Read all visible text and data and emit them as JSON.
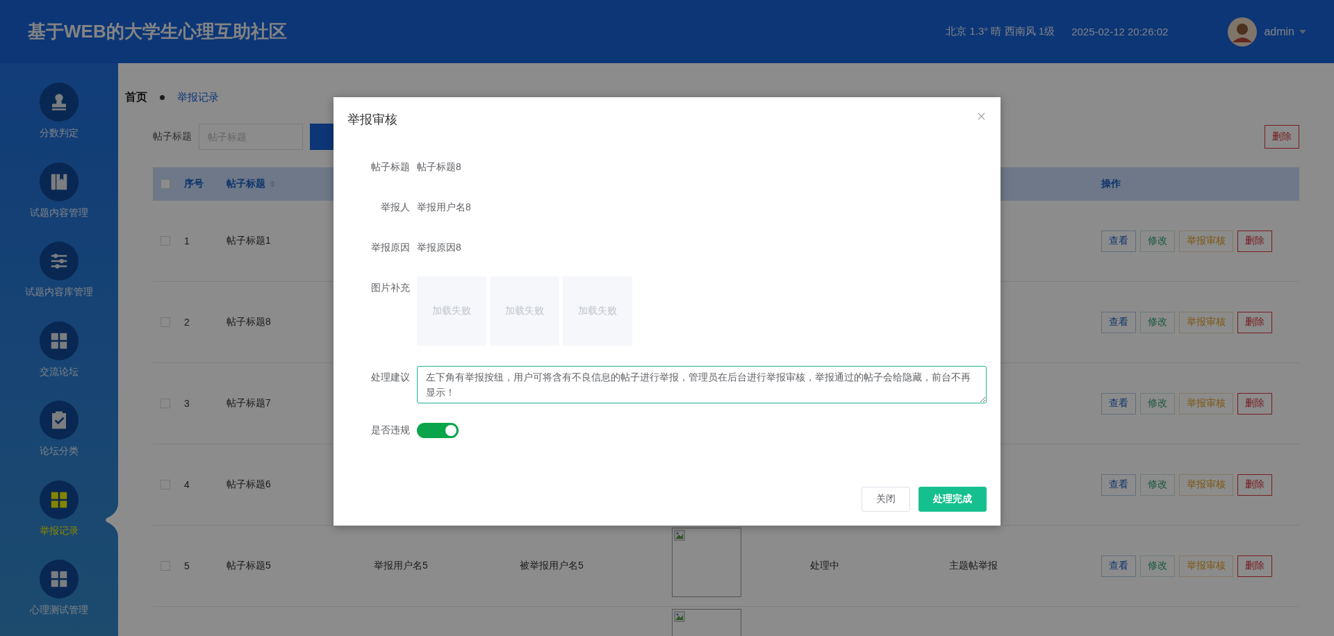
{
  "header": {
    "title": "基于WEB的大学生心理互助社区",
    "weather": "北京 1.3° 晴 西南风 1级",
    "datetime": "2025-02-12 20:26:02",
    "user": "admin"
  },
  "sidebar": {
    "items": [
      {
        "label": "分数判定",
        "kind": "stamp",
        "selected": false
      },
      {
        "label": "试题内容管理",
        "kind": "book",
        "selected": false
      },
      {
        "label": "试题内容库管理",
        "kind": "sliders",
        "selected": false
      },
      {
        "label": "交流论坛",
        "kind": "grid",
        "selected": false
      },
      {
        "label": "论坛分类",
        "kind": "clipboard",
        "selected": false
      },
      {
        "label": "举报记录",
        "kind": "grid",
        "selected": true
      },
      {
        "label": "心理测试管理",
        "kind": "grid",
        "selected": false
      }
    ]
  },
  "breadcrumb": [
    "首页",
    "举报记录"
  ],
  "search": {
    "label": "帖子标题",
    "placeholder": "帖子标题"
  },
  "delete_button": "删除",
  "table": {
    "header_checked": false,
    "columns": [
      {
        "label": "序号",
        "kind": "plain"
      },
      {
        "label": "帖子标题",
        "kind": "sortable"
      }
    ],
    "actions_column": "操作",
    "rows": [
      {
        "checked": false,
        "no": "1",
        "title": "帖子标题1",
        "actions": [
          {
            "label": "查看",
            "kind": "view"
          },
          {
            "label": "修改",
            "kind": "edit"
          },
          {
            "label": "举报审核",
            "kind": "audit"
          },
          {
            "label": "删除",
            "kind": "delete"
          }
        ]
      },
      {
        "checked": false,
        "no": "2",
        "title": "帖子标题8",
        "actions": [
          {
            "label": "查看",
            "kind": "view"
          },
          {
            "label": "修改",
            "kind": "edit"
          },
          {
            "label": "举报审核",
            "kind": "audit"
          },
          {
            "label": "删除",
            "kind": "delete"
          }
        ]
      },
      {
        "checked": false,
        "no": "3",
        "title": "帖子标题7",
        "actions": [
          {
            "label": "查看",
            "kind": "view"
          },
          {
            "label": "修改",
            "kind": "edit"
          },
          {
            "label": "举报审核",
            "kind": "audit"
          },
          {
            "label": "删除",
            "kind": "delete"
          }
        ]
      },
      {
        "checked": false,
        "no": "4",
        "title": "帖子标题6",
        "actions": [
          {
            "label": "查看",
            "kind": "view"
          },
          {
            "label": "修改",
            "kind": "edit"
          },
          {
            "label": "举报审核",
            "kind": "audit"
          },
          {
            "label": "删除",
            "kind": "delete"
          }
        ]
      },
      {
        "checked": false,
        "no": "5",
        "title": "帖子标题5",
        "reporter": "举报用户名5",
        "reported": "被举报用户名5",
        "image": {
          "kind": "broken"
        },
        "status": "处理中",
        "type": "主题帖举报",
        "actions": [
          {
            "label": "查看",
            "kind": "view"
          },
          {
            "label": "修改",
            "kind": "edit"
          },
          {
            "label": "举报审核",
            "kind": "audit"
          },
          {
            "label": "删除",
            "kind": "delete"
          }
        ]
      },
      {
        "image": {
          "kind": "broken"
        }
      }
    ]
  },
  "modal": {
    "title": "举报审核",
    "fields": [
      {
        "label": "帖子标题",
        "value": "帖子标题8"
      },
      {
        "label": "举报人",
        "value": "举报用户名8"
      },
      {
        "label": "举报原因",
        "value": "举报原因8"
      }
    ],
    "images_label": "图片补充",
    "images": [
      "加载失败",
      "加载失败",
      "加载失败"
    ],
    "advice_label": "处理建议",
    "advice": "左下角有举报按纽，用户可将含有不良信息的帖子进行举报，管理员在后台进行举报审核，举报通过的帖子会给隐藏，前台不再显示！",
    "violation_label": "是否违规",
    "violation": true,
    "buttons": [
      {
        "label": "关闭",
        "kind": "plain"
      },
      {
        "label": "处理完成",
        "kind": "primary"
      }
    ]
  }
}
